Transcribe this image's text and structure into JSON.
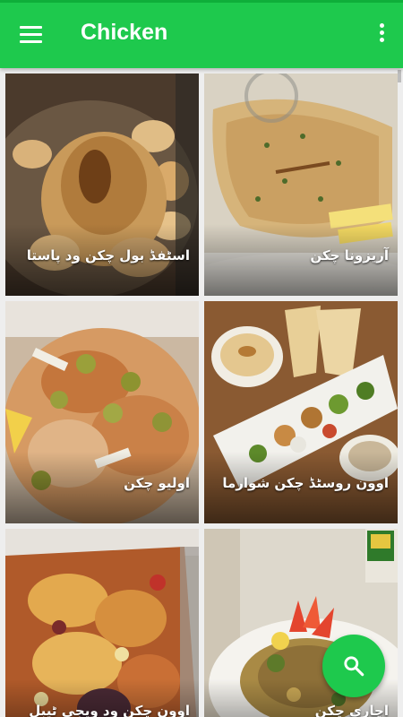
{
  "app_bar": {
    "title": "Chicken",
    "menu_icon": "hamburger-menu-icon",
    "overflow_icon": "more-vert-icon",
    "color": "#1ec94d"
  },
  "recipes": [
    {
      "name": "اسٹفڈ بول چکن ود پاستا"
    },
    {
      "name": "آریزونا چکن"
    },
    {
      "name": "اولیو چکن"
    },
    {
      "name": "اوون روسٹڈ چکن شوارما"
    },
    {
      "name": "اوون چکن ود ویجی ٹیبل"
    },
    {
      "name": "اچاری چکن"
    }
  ],
  "fab": {
    "icon": "search-icon",
    "color": "#1ec94d"
  }
}
